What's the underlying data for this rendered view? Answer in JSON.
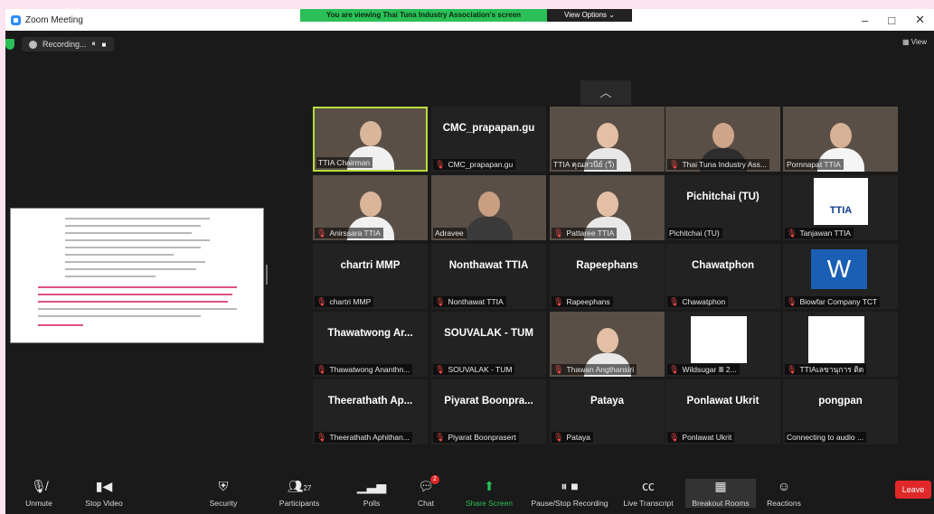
{
  "window": {
    "title": "Zoom Meeting",
    "controls": [
      "–",
      "□",
      "✕"
    ]
  },
  "share": {
    "banner": "You are viewing Thai Tuna Industry Association's screen",
    "view_options": "View Options ⌄"
  },
  "recording": {
    "label": "Recording...",
    "pause": "⏸",
    "stop": "■"
  },
  "view_label": "View",
  "participants": [
    {
      "label": "TTIA Chairman",
      "big": "",
      "video": true,
      "muted": false,
      "active": true
    },
    {
      "label": "CMC_prapapan.gu",
      "big": "CMC_prapapan.gu",
      "video": false,
      "muted": true
    },
    {
      "label": "TTIA คุณสวนีย์ (วี)",
      "big": "",
      "video": true,
      "muted": false
    },
    {
      "label": "Thai Tuna Industry Ass...",
      "big": "",
      "video": true,
      "muted": true
    },
    {
      "label": "Pornnapat TTIA",
      "big": "",
      "video": true,
      "muted": false
    },
    {
      "label": "Anirssara TTIA",
      "big": "",
      "video": true,
      "muted": true
    },
    {
      "label": "Adravee",
      "big": "",
      "video": true,
      "muted": false
    },
    {
      "label": "Pattaree TTIA",
      "big": "",
      "video": true,
      "muted": true
    },
    {
      "label": "Pichitchai (TU)",
      "big": "Pichitchai (TU)",
      "video": false,
      "muted": false
    },
    {
      "label": "Tanjawan TTIA",
      "big": "",
      "video": false,
      "muted": true,
      "logo": "TTIA"
    },
    {
      "label": "chartri MMP",
      "big": "chartri MMP",
      "video": false,
      "muted": true
    },
    {
      "label": "Nonthawat TTIA",
      "big": "Nonthawat TTIA",
      "video": false,
      "muted": true
    },
    {
      "label": "Rapeephans",
      "big": "Rapeephans",
      "video": false,
      "muted": true
    },
    {
      "label": "Chawatphon",
      "big": "Chawatphon",
      "video": false,
      "muted": true
    },
    {
      "label": "Biowfar Company TCT",
      "big": "",
      "video": false,
      "muted": true,
      "logo": "W"
    },
    {
      "label": "Thawatwong Ananthn...",
      "big": "Thawatwong Ar...",
      "video": false,
      "muted": true
    },
    {
      "label": "SOUVALAK - TUM",
      "big": "SOUVALAK - TUM",
      "video": false,
      "muted": true
    },
    {
      "label": "Thawan Angthansiri",
      "big": "",
      "video": true,
      "muted": true
    },
    {
      "label": "Wildsugar Ⅲ 2...",
      "big": "",
      "video": false,
      "muted": true,
      "blank": true
    },
    {
      "label": "TTIAเลขานุการ ติด",
      "big": "",
      "video": false,
      "muted": true,
      "blank": true
    },
    {
      "label": "Theerathath Aphithan...",
      "big": "Theerathath Ap...",
      "video": false,
      "muted": true
    },
    {
      "label": "Piyarat Boonprasert",
      "big": "Piyarat Boonpra...",
      "video": false,
      "muted": true
    },
    {
      "label": "Pataya",
      "big": "Pataya",
      "video": false,
      "muted": true
    },
    {
      "label": "Ponlawat Ukrit",
      "big": "Ponlawat Ukrit",
      "video": false,
      "muted": true
    },
    {
      "label": "Connecting to audio ...",
      "big": "pongpan",
      "video": false,
      "muted": false
    }
  ],
  "toolbar": {
    "unmute": "Unmute",
    "stop_video": "Stop Video",
    "security": "Security",
    "participants": "Participants",
    "participants_count": "27",
    "polls": "Polls",
    "chat": "Chat",
    "chat_badge": "2",
    "share_screen": "Share Screen",
    "pause_recording": "Pause/Stop Recording",
    "live_transcript": "Live Transcript",
    "breakout_rooms": "Breakout Rooms",
    "reactions": "Reactions",
    "leave": "Leave"
  }
}
